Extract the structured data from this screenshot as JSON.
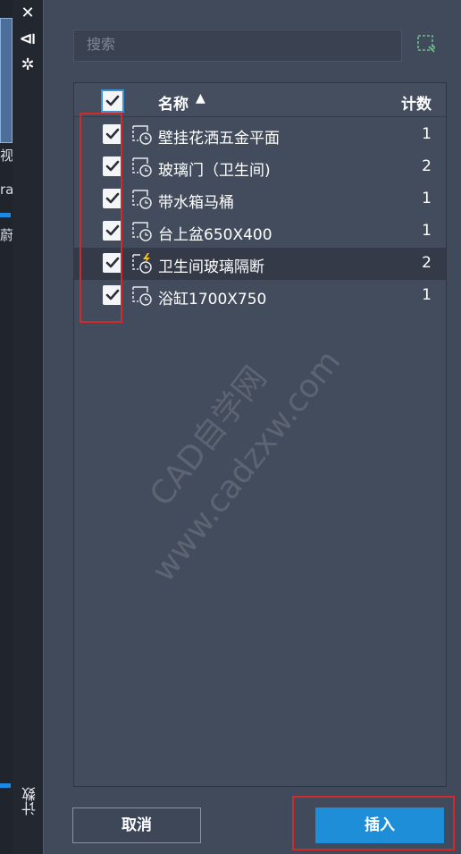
{
  "left_edge": {
    "fragments": [
      "视",
      "ra",
      "蔚"
    ]
  },
  "toolbar": {
    "close_glyph": "✕",
    "collapse_glyph": "⧏",
    "settings_glyph": "✲",
    "vertical_label": "计数"
  },
  "search": {
    "placeholder": "搜索"
  },
  "list": {
    "header": {
      "name_label": "名称",
      "sort_indicator": "▲",
      "count_label": "计数"
    },
    "rows": [
      {
        "name": "壁挂花洒五金平面",
        "count": "1",
        "checked": true,
        "icon": "block-icon"
      },
      {
        "name": "玻璃门（卫生间)",
        "count": "2",
        "checked": true,
        "icon": "block-icon"
      },
      {
        "name": "带水箱马桶",
        "count": "1",
        "checked": true,
        "icon": "block-icon"
      },
      {
        "name": "台上盆650X400",
        "count": "1",
        "checked": true,
        "icon": "block-icon"
      },
      {
        "name": "卫生间玻璃隔断",
        "count": "2",
        "checked": true,
        "icon": "dynamic-block-icon"
      },
      {
        "name": "浴缸1700X750",
        "count": "1",
        "checked": true,
        "icon": "block-icon"
      }
    ]
  },
  "watermark": {
    "line1": "CAD自学网",
    "line2": "www.cadzxw.com"
  },
  "buttons": {
    "cancel_label": "取消",
    "insert_label": "插入"
  },
  "colors": {
    "panel_bg": "#414a5a",
    "list_bg": "#434c5c",
    "accent_blue": "#1e8ed8",
    "highlight_red": "#d22a2a",
    "lightning_yellow": "#f3c21b"
  }
}
